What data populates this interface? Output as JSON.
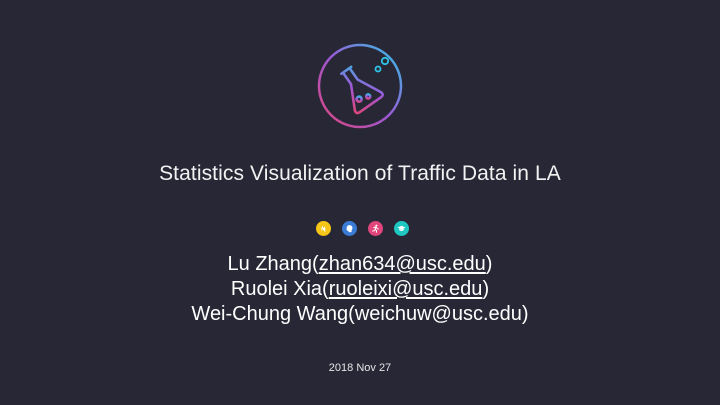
{
  "slide": {
    "title": "Statistics Visualization of Traffic Data in LA",
    "authors": [
      {
        "name": "Lu Zhang",
        "open": "(",
        "email": "zhan634@usc.edu",
        "close": ")",
        "linked": true
      },
      {
        "name": "Ruolei Xia",
        "open": "(",
        "email": "ruoleixi@usc.edu",
        "close": ")",
        "linked": true
      },
      {
        "name": "Wei-Chung Wang",
        "open": "(",
        "email": "weichuw@usc.edu",
        "close": ")",
        "linked": false
      }
    ],
    "date": "2018 Nov 27"
  },
  "logo": {
    "icon": "flask-icon",
    "ring_gradient": [
      "#e0457b",
      "#9b59d6",
      "#2ec4e6"
    ]
  },
  "icons": [
    {
      "name": "hand-icon",
      "color": "#f5c518"
    },
    {
      "name": "head-icon",
      "color": "#3a7bd5"
    },
    {
      "name": "runner-icon",
      "color": "#e0457b"
    },
    {
      "name": "graduation-cap-icon",
      "color": "#1fc7c2"
    }
  ],
  "colors": {
    "background": "#272736",
    "text": "#ffffff"
  }
}
